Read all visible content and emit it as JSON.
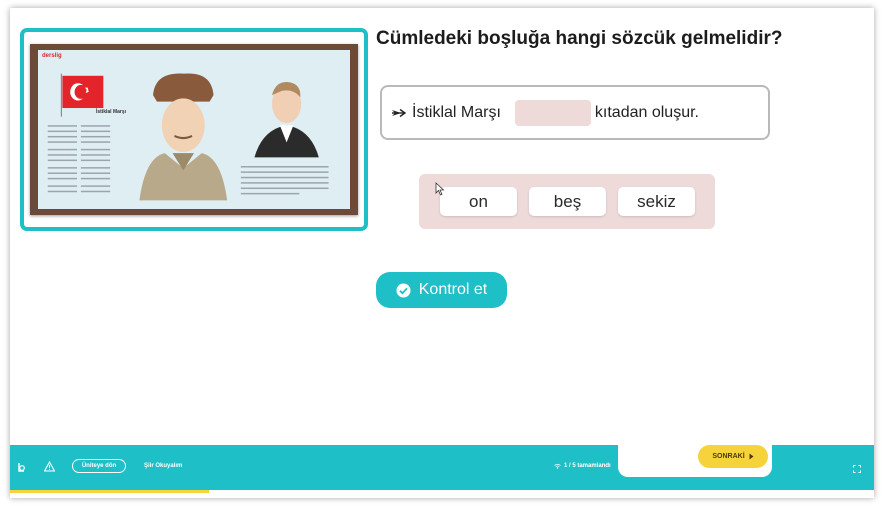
{
  "question": {
    "title": "Cümledeki boşluğa hangi sözcük gelmelidir?",
    "sentence_before": "İstiklal Marşı",
    "sentence_after": "kıtadan oluşur.",
    "arrow_icon": "arrow-right-icon"
  },
  "options": [
    {
      "label": "on"
    },
    {
      "label": "beş"
    },
    {
      "label": "sekiz"
    }
  ],
  "check_button": {
    "label": "Kontrol et",
    "icon": "check-circle-icon"
  },
  "footer": {
    "back_label": "Üniteye dön",
    "lesson_title": "Şiir Okuyalım",
    "progress_text": "1 / 5 tamamlandı",
    "progress_fraction": 0.23,
    "next_label": "SONRAKİ"
  },
  "poster": {
    "brand": "derslig",
    "heading": "İstiklal Marşı",
    "flag_color": "#e3242b"
  },
  "colors": {
    "accent": "#1fbfc7",
    "slot": "#efdada",
    "next": "#f6d33a"
  }
}
